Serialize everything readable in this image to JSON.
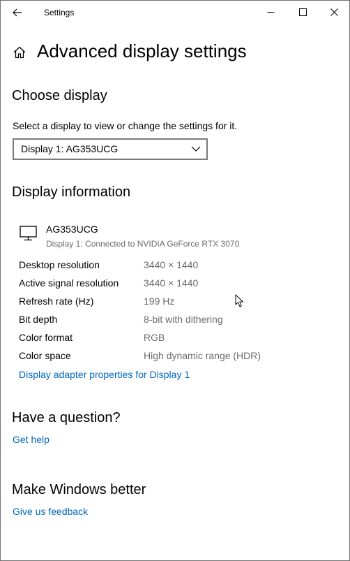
{
  "window": {
    "title": "Settings"
  },
  "header": {
    "title": "Advanced display settings"
  },
  "choose_display": {
    "heading": "Choose display",
    "label": "Select a display to view or change the settings for it.",
    "selected": "Display 1: AG353UCG"
  },
  "display_info": {
    "heading": "Display information",
    "monitor_name": "AG353UCG",
    "monitor_description": "Display 1: Connected to NVIDIA GeForce RTX 3070",
    "rows": [
      {
        "label": "Desktop resolution",
        "value": "3440 × 1440"
      },
      {
        "label": "Active signal resolution",
        "value": "3440 × 1440"
      },
      {
        "label": "Refresh rate (Hz)",
        "value": "199 Hz"
      },
      {
        "label": "Bit depth",
        "value": "8-bit with dithering"
      },
      {
        "label": "Color format",
        "value": "RGB"
      },
      {
        "label": "Color space",
        "value": "High dynamic range (HDR)"
      }
    ],
    "adapter_link": "Display adapter properties for Display 1"
  },
  "question": {
    "heading": "Have a question?",
    "link": "Get help"
  },
  "better": {
    "heading": "Make Windows better",
    "link": "Give us feedback"
  },
  "icons": {
    "back": "back-arrow-icon",
    "minimize": "minimize-icon",
    "maximize": "maximize-icon",
    "close": "close-icon",
    "home": "home-icon",
    "monitor": "monitor-icon",
    "chevron": "chevron-down-icon",
    "cursor": "mouse-cursor-icon"
  },
  "colors": {
    "link": "#0067c0",
    "secondary_text": "#6b6b6b",
    "border": "#7a7a7a"
  }
}
